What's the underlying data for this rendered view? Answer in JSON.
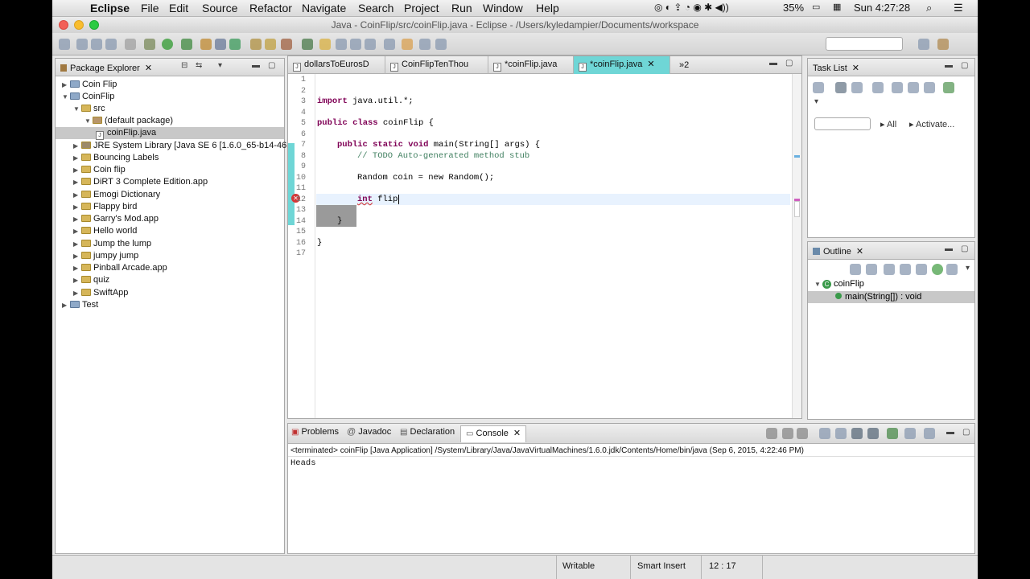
{
  "menubar": {
    "app_name": "Eclipse",
    "items": [
      "File",
      "Edit",
      "Source",
      "Refactor",
      "Navigate",
      "Search",
      "Project",
      "Run",
      "Window",
      "Help"
    ],
    "battery": "35%",
    "clock": "Sun 4:27:28"
  },
  "window": {
    "title": "Java - CoinFlip/src/coinFlip.java - Eclipse - /Users/kyledampier/Documents/workspace"
  },
  "package_explorer": {
    "title": "Package Explorer",
    "items": [
      {
        "label": "Coin Flip"
      },
      {
        "label": "CoinFlip"
      },
      {
        "label": "src"
      },
      {
        "label": "(default package)"
      },
      {
        "label": "coinFlip.java"
      },
      {
        "label": "JRE System Library [Java SE 6 [1.6.0_65-b14-46"
      },
      {
        "label": "Bouncing Labels"
      },
      {
        "label": "Coin flip"
      },
      {
        "label": "DiRT 3 Complete Edition.app"
      },
      {
        "label": "Emogi Dictionary"
      },
      {
        "label": "Flappy bird"
      },
      {
        "label": "Garry's Mod.app"
      },
      {
        "label": "Hello world"
      },
      {
        "label": "Jump the lump"
      },
      {
        "label": "jumpy jump"
      },
      {
        "label": "Pinball Arcade.app"
      },
      {
        "label": "quiz"
      },
      {
        "label": "SwiftApp"
      },
      {
        "label": "Test"
      }
    ]
  },
  "editor": {
    "tabs": [
      {
        "label": "dollarsToEurosD"
      },
      {
        "label": "CoinFlipTenThou"
      },
      {
        "label": "*coinFlip.java"
      },
      {
        "label": "*coinFlip.java"
      }
    ],
    "overflow_label": "»2",
    "line_numbers": [
      "1",
      "2",
      "3",
      "4",
      "5",
      "6",
      "7",
      "8",
      "9",
      "10",
      "11",
      "12",
      "13",
      "14",
      "15",
      "16",
      "17"
    ],
    "lines": {
      "l3_kw": "import",
      "l3_rest": " java.util.*;",
      "l5_kw": "public class",
      "l5_rest": " coinFlip {",
      "l7_kw": "public static void",
      "l7_rest": " main(String[] args) {",
      "l8": "// TODO Auto-generated method stub",
      "l10": "Random coin = new Random();",
      "l12_kw": "int",
      "l12_rest": " flip",
      "l14": "}",
      "l16": "}"
    }
  },
  "task_list": {
    "title": "Task List",
    "filter_all": "All",
    "activate": "Activate..."
  },
  "outline": {
    "title": "Outline",
    "class_name": "coinFlip",
    "method": "main(String[]) : void"
  },
  "bottom": {
    "tabs": [
      {
        "label": "Problems"
      },
      {
        "label": "Javadoc"
      },
      {
        "label": "Declaration"
      },
      {
        "label": "Console"
      }
    ],
    "console_header": "<terminated> coinFlip [Java Application] /System/Library/Java/JavaVirtualMachines/1.6.0.jdk/Contents/Home/bin/java (Sep 6, 2015, 4:22:46 PM)",
    "console_output": "Heads"
  },
  "status": {
    "writable": "Writable",
    "insert_mode": "Smart Insert",
    "position": "12 : 17"
  }
}
